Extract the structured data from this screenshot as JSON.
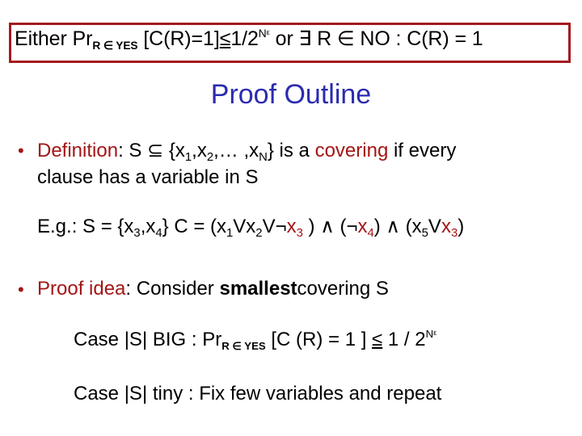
{
  "claim": {
    "either": "Either Pr",
    "sub1": "R ∈ YES",
    "expr1": " [C(R)=1]",
    "leq": "≤",
    "frac": "1/2",
    "sup_n": "N",
    "sup_eps": "ε",
    "or_part": " or ∃ R ∈ NO : C(R) = 1"
  },
  "title": "Proof Outline",
  "bullets": [
    {
      "label": "Definition",
      "line1": {
        "colon": ": S ⊆ {x",
        "s1": "1",
        "c1": ",x",
        "s2": "2",
        "c2": ",… ,x",
        "sN": "N",
        "c3": "} is a ",
        "covering": "covering",
        "c4": " if every"
      },
      "line2": "clause has a variable in S"
    },
    {
      "label": "Proof idea",
      "text1": ": Consider ",
      "bold": "smallest",
      "text2": "covering S"
    }
  ],
  "example": {
    "eg": "E.g.:  S = {x",
    "s3": "3",
    "comma": ",x",
    "s4": "4",
    "close": "}  C = (x",
    "c_s1": "1",
    "v1": "Vx",
    "c_s2": "2",
    "v2": "V¬",
    "x3a": "x",
    "x3a_sub": "3",
    "p1": " ) ∧ (¬",
    "x4": "x",
    "x4_sub": "4",
    "p2": ") ∧ (x",
    "c_s5": "5",
    "v3": "V",
    "x3b": "x",
    "x3b_sub": "3",
    "p3": ")"
  },
  "cases": [
    {
      "pre": "Case |S| BIG : Pr",
      "sub": "R ∈ YES",
      "mid": " [C (R) = 1 ] ",
      "leq": "≤",
      "post": " 1 / 2",
      "sup_n": "N",
      "sup_eps": "ε"
    },
    {
      "text": "Case |S| tiny : Fix few variables and repeat"
    }
  ],
  "colors": {
    "accent_red": "#a31515",
    "title_blue": "#2b2bb0",
    "box_border": "#a31a1f"
  }
}
